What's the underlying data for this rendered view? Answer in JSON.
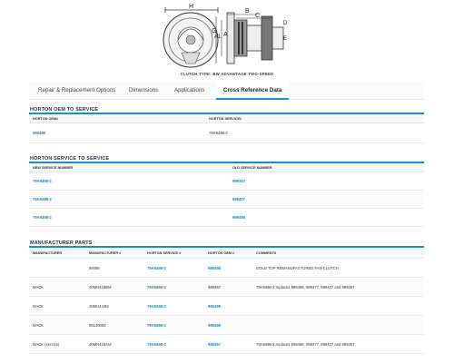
{
  "diagram": {
    "caption": "CLUTCH TYPE: BW ADVANTAGE TWO-SPEED",
    "labels": [
      "H",
      "B",
      "C",
      "D",
      "E",
      "G",
      "A1",
      "A"
    ]
  },
  "tabs": [
    {
      "label": "Repair & Replacement Options",
      "active": false
    },
    {
      "label": "Dimensions",
      "active": false
    },
    {
      "label": "Applications",
      "active": false
    },
    {
      "label": "Cross Reference Data",
      "active": true
    }
  ],
  "oem_to_service": {
    "title": "HORTON OEM TO SERVICE",
    "headers": [
      "HORTON OEM#",
      "HORTON SERVICE#"
    ],
    "rows": [
      [
        "999498",
        "79A9498-2"
      ]
    ]
  },
  "service_to_service": {
    "title": "HORTON SERVICE TO SERVICE",
    "headers": [
      "NEW SERVICE NUMBER",
      "OLD SERVICE NUMBER"
    ],
    "rows": [
      [
        "79A9498-2",
        "999357"
      ],
      [
        "79A9498-2",
        "999477"
      ],
      [
        "79A9498-2",
        "999498"
      ]
    ]
  },
  "manufacturer_parts": {
    "title": "MANUFACTURER PARTS",
    "headers": [
      "MANUFACTURER",
      "MANUFACTURER #",
      "HORTON SERVICE #",
      "HORTON OEM #",
      "COMMENTS"
    ],
    "rows": [
      [
        "",
        "99498",
        "79A9498-2",
        "989498",
        "GOLD TOP REMANUFACTURED FAN CLUTCH"
      ],
      [
        "MACK",
        "40MH418BM",
        "79A9498-2",
        "989357",
        "79A9498-2 replaces 999498, 999477, 999427 and 999357"
      ],
      [
        "MACK",
        "40MH444M",
        "79A9498-2",
        "989498",
        ""
      ],
      [
        "MACK",
        "85130082",
        "79A9498-2",
        "989498",
        ""
      ],
      [
        "MACK (service)",
        "40MH418AM",
        "79A9498-2",
        "989357",
        "79A9498-2 replaces 999498, 999477, 999427 and 999357"
      ]
    ]
  }
}
